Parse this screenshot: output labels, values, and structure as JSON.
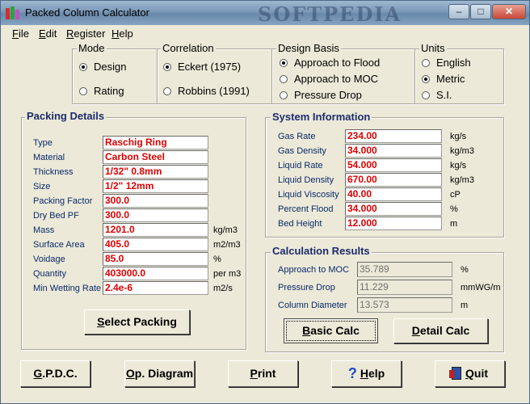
{
  "window": {
    "title": "Packed Column Calculator",
    "watermark": "SOFTPEDIA"
  },
  "menu": [
    "File",
    "Edit",
    "Register",
    "Help"
  ],
  "mode": {
    "label": "Mode",
    "options": [
      "Design",
      "Rating"
    ],
    "selected": "Design"
  },
  "correlation": {
    "label": "Correlation",
    "options": [
      "Eckert (1975)",
      "Robbins (1991)"
    ],
    "selected": "Eckert (1975)"
  },
  "design_basis": {
    "label": "Design Basis",
    "options": [
      "Approach to Flood",
      "Approach to MOC",
      "Pressure Drop"
    ],
    "selected": "Approach to Flood"
  },
  "units": {
    "label": "Units",
    "options": [
      "English",
      "Metric",
      "S.I."
    ],
    "selected": "Metric"
  },
  "packing": {
    "title": "Packing Details",
    "rows": [
      {
        "label": "Type",
        "value": "Raschig Ring",
        "unit": ""
      },
      {
        "label": "Material",
        "value": "Carbon Steel",
        "unit": ""
      },
      {
        "label": "Thickness",
        "value": "1/32\"  0.8mm",
        "unit": ""
      },
      {
        "label": "Size",
        "value": "1/2\"  12mm",
        "unit": ""
      },
      {
        "label": "Packing Factor",
        "value": "300.0",
        "unit": ""
      },
      {
        "label": "Dry Bed PF",
        "value": "300.0",
        "unit": ""
      },
      {
        "label": "Mass",
        "value": "1201.0",
        "unit": "kg/m3"
      },
      {
        "label": "Surface Area",
        "value": "405.0",
        "unit": "m2/m3"
      },
      {
        "label": "Voidage",
        "value": "85.0",
        "unit": "%"
      },
      {
        "label": "Quantity",
        "value": "403000.0",
        "unit": "per m3"
      },
      {
        "label": "Min Wetting Rate",
        "value": "2.4e-6",
        "unit": "m2/s"
      }
    ],
    "button": "Select Packing"
  },
  "system": {
    "title": "System Information",
    "rows": [
      {
        "label": "Gas Rate",
        "value": "234.00",
        "unit": "kg/s"
      },
      {
        "label": "Gas Density",
        "value": "34.000",
        "unit": "kg/m3"
      },
      {
        "label": "Liquid Rate",
        "value": "54.000",
        "unit": "kg/s"
      },
      {
        "label": "Liquid Density",
        "value": "670.00",
        "unit": "kg/m3"
      },
      {
        "label": "Liquid Viscosity",
        "value": "40.00",
        "unit": "cP"
      },
      {
        "label": "Percent Flood",
        "value": "34.000",
        "unit": "%"
      },
      {
        "label": "Bed Height",
        "value": "12.000",
        "unit": "m"
      }
    ]
  },
  "results": {
    "title": "Calculation Results",
    "rows": [
      {
        "label": "Approach to MOC",
        "value": "35.789",
        "unit": "%"
      },
      {
        "label": "Pressure Drop",
        "value": "11.229",
        "unit": "mmWG/m"
      },
      {
        "label": "Column Diameter",
        "value": "13.573",
        "unit": "m"
      }
    ],
    "basic_calc": "Basic Calc",
    "detail_calc": "Detail Calc"
  },
  "bottom": {
    "gpdc": "G.P.D.C.",
    "op_diagram": "Op. Diagram",
    "print": "Print",
    "help": "Help",
    "quit": "Quit"
  }
}
